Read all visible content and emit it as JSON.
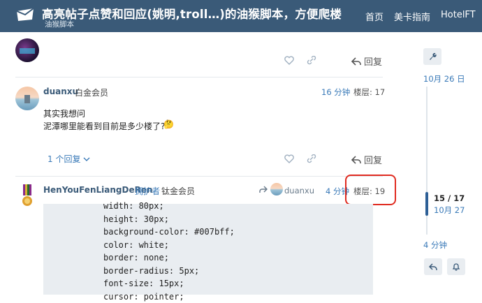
{
  "header": {
    "title": "高亮帖子点赞和回应(姚明,troll…)的油猴脚本，方便爬楼",
    "subtitle": "油猴脚本",
    "nav": [
      "首页",
      "美卡指南",
      "HotelFT"
    ]
  },
  "post_top": {
    "reply_label": "回复"
  },
  "post_17": {
    "username": "duanxu",
    "user_title": "白金会员",
    "time": "16 分钟",
    "floor": "楼层: 17",
    "lines": [
      "其实我想问",
      "泥潭哪里能看到目前是多少楼了?"
    ],
    "emoji": "🤔",
    "replies_label": "1 个回复",
    "reply_label": "回复"
  },
  "post_19": {
    "username": "HenYouFenLiangDeRen",
    "role": "拥护者",
    "user_title": "钛金会员",
    "reply_to": "duanxu",
    "time": "4 分钟",
    "floor": "楼层: 19",
    "code_lines": [
      "width: 80px;",
      "height: 30px;",
      "background-color: #007bff;",
      "color: white;",
      "border: none;",
      "border-radius: 5px;",
      "font-size: 15px;",
      "cursor: pointer;"
    ]
  },
  "timeline": {
    "start_date": "10月 26 日",
    "position": "15 / 17",
    "current_date": "10月 27",
    "last": "4 分钟"
  },
  "colors": {
    "header_bg": "#3a5a78",
    "link": "#3a7ab8",
    "highlight": "#e02b20"
  }
}
